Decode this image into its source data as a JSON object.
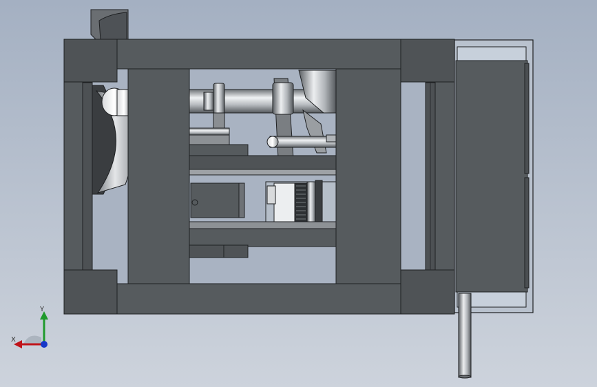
{
  "viewport": {
    "background_top": "#a4b0c2",
    "background_bottom": "#cdd3dc"
  },
  "model_colors": {
    "body": "#565b5e",
    "body_dark": "#45494c",
    "edge": "#1e2022",
    "steel_light": "#eef0f2",
    "steel_mid": "#a9adb1",
    "steel_dark": "#5a5e62"
  },
  "triad": {
    "x_label": "X",
    "y_label": "Y",
    "x_color": "#c0141a",
    "y_color": "#1f9a2c",
    "z_color": "#1638c8"
  }
}
